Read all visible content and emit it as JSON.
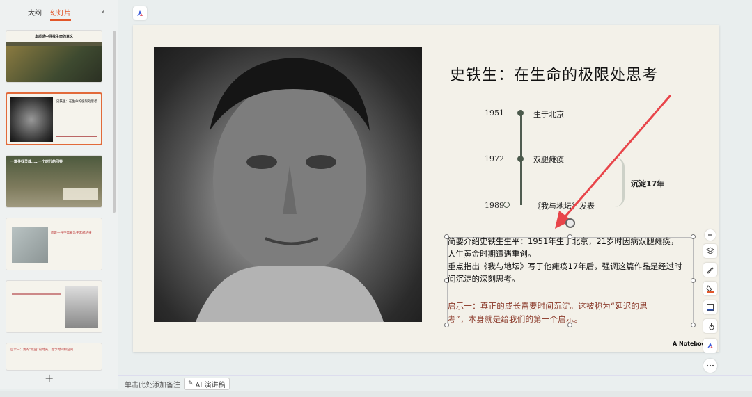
{
  "sidebar": {
    "tabs": [
      "大纲",
      "幻灯片"
    ],
    "active_tab": "幻灯片",
    "collapse_icon": "chevron-left-icon",
    "thumbnails": [
      {
        "title": "本质感中寻找生命的意义",
        "subtitle": "",
        "bg": "#6b6a52"
      },
      {
        "title": "史铁生：在生命的极限处思考",
        "subtitle": "",
        "bg": "#f5f3ec"
      },
      {
        "title": "一篇寻找灵魂……一个时代的回答",
        "subtitle": "",
        "bg": "#55604a"
      },
      {
        "title": "而是一件不需要急于求成的事",
        "subtitle": "",
        "bg": "#f5f3ec"
      },
      {
        "title": "",
        "subtitle": "",
        "bg": "#f5f3ec"
      },
      {
        "title": "启示一：我的“荒园”的时光，给予时间和空间",
        "subtitle": "",
        "bg": "#f5f3ec"
      }
    ],
    "add_label": "+"
  },
  "slide": {
    "title": "史铁生：在生命的极限处思考",
    "timeline": [
      {
        "year": "1951",
        "event": "生于北京",
        "marker": "filled"
      },
      {
        "year": "1972",
        "event": "双腿瘫痪",
        "marker": "filled"
      },
      {
        "year": "1989",
        "event": "《我与地坛》发表",
        "marker": "hollow"
      }
    ],
    "brace_label": "沉淀17年",
    "text_lines": [
      "简要介绍史铁生生平：1951年生于北京，21岁时因病双腿瘫痪，",
      "人生黄金时期遭遇重创。",
      "重点指出《我与地坛》写于他瘫痪17年后，强调这篇作品是经过时",
      "间沉淀的深刻思考。"
    ],
    "red_lines": [
      "启示一：真正的成长需要时间沉淀。这被称为“延迟的思",
      "考”，本身就是给我们的第一个启示。"
    ],
    "watermark": "A Noteboo"
  },
  "toolbar_right": [
    "minus-icon",
    "layers-icon",
    "brush-icon",
    "fill-icon",
    "frame-icon",
    "shape-icon",
    "app-logo-icon",
    "more-icon"
  ],
  "notes": {
    "placeholder": "单击此处添加备注",
    "ai_button": "AI 演讲稿"
  },
  "colors": {
    "accent": "#e2572a",
    "timeline": "#4b5a4c",
    "red_text": "#8b3a2a",
    "arrow": "#e8454a"
  }
}
